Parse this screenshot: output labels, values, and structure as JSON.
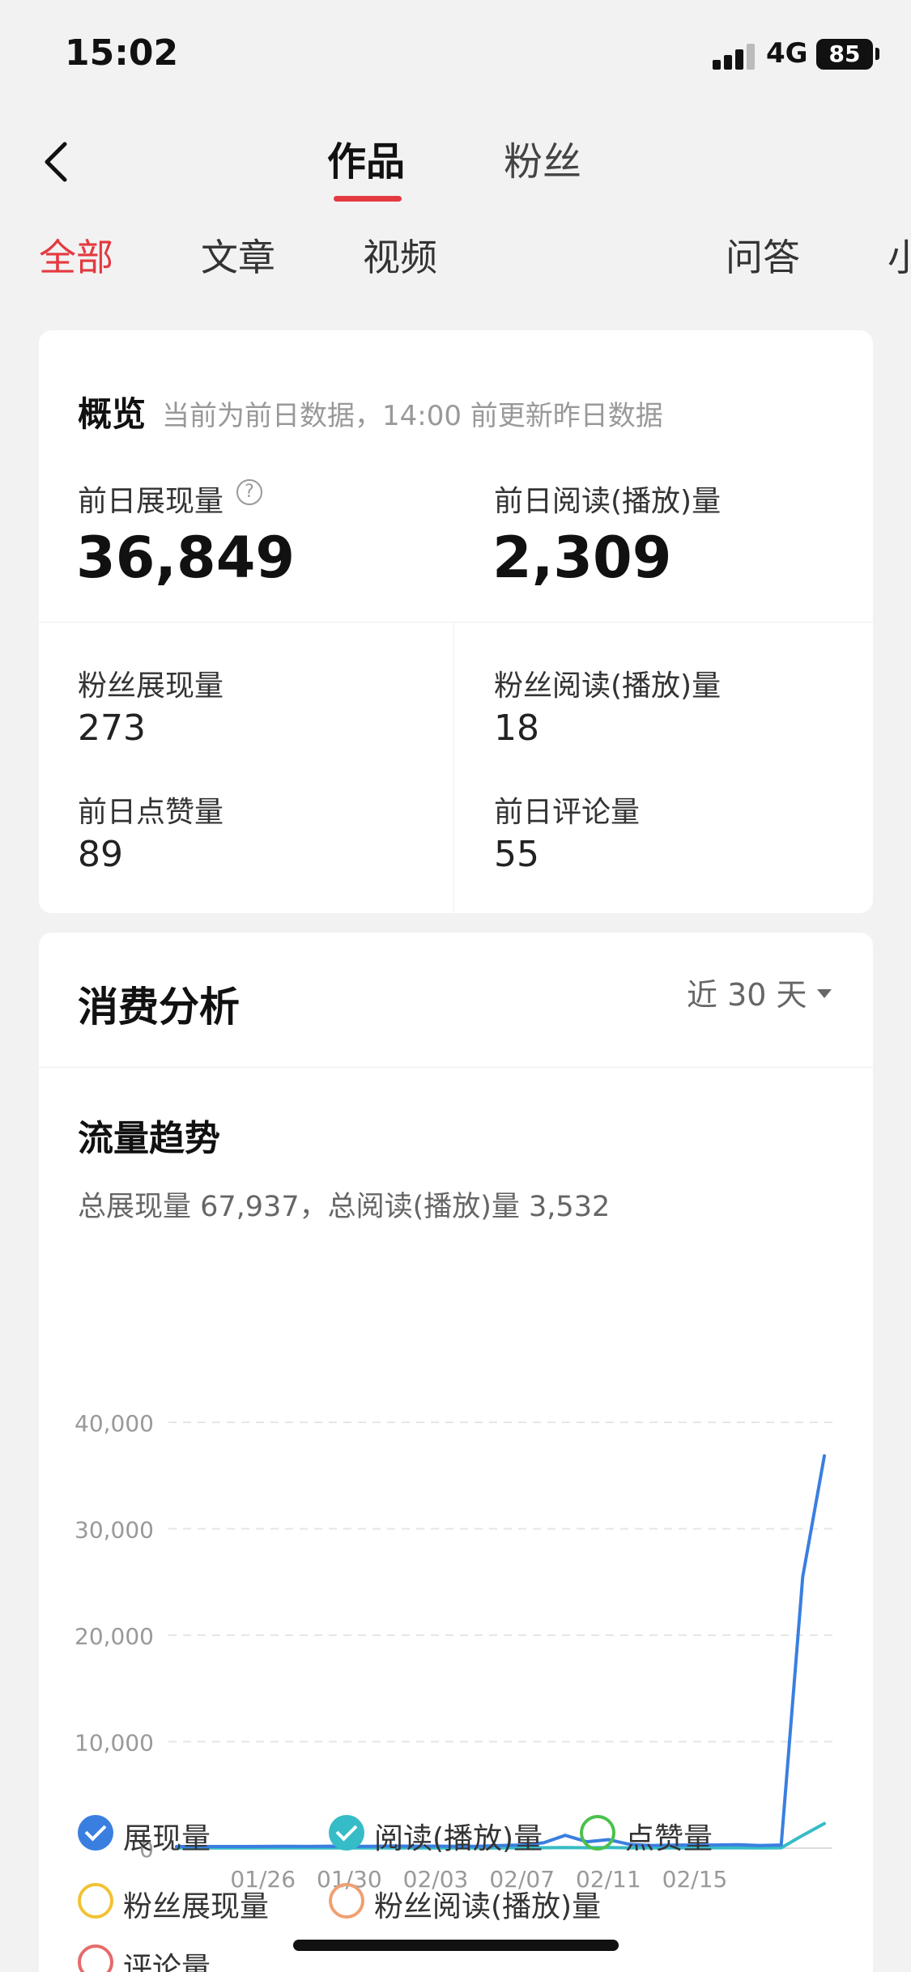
{
  "status_bar": {
    "time": "15:02",
    "network": "4G",
    "battery": "85"
  },
  "nav": {
    "tabs": [
      {
        "label": "作品"
      },
      {
        "label": "粉丝"
      }
    ],
    "categories": [
      {
        "label": "全部"
      },
      {
        "label": "文章"
      },
      {
        "label": "视频"
      },
      {
        "label": "问答"
      },
      {
        "label": "小"
      }
    ]
  },
  "overview": {
    "title": "概览",
    "subtitle": "当前为前日数据，14:00 前更新昨日数据",
    "impressions_label": "前日展现量",
    "impressions_value": "36,849",
    "reads_label": "前日阅读(播放)量",
    "reads_value": "2,309",
    "fan_impressions_label": "粉丝展现量",
    "fan_impressions_value": "273",
    "fan_reads_label": "粉丝阅读(播放)量",
    "fan_reads_value": "18",
    "likes_label": "前日点赞量",
    "likes_value": "89",
    "comments_label": "前日评论量",
    "comments_value": "55"
  },
  "consumption": {
    "title": "消费分析",
    "range": "近 30 天",
    "trend_title": "流量趋势",
    "trend_summary": "总展现量 67,937，总阅读(播放)量 3,532"
  },
  "chart_data": {
    "type": "line",
    "ylim": [
      0,
      40000
    ],
    "y_ticks": [
      "0",
      "10,000",
      "20,000",
      "30,000",
      "40,000"
    ],
    "x_tick_labels": [
      "01/26",
      "01/30",
      "02/03",
      "02/07",
      "02/11",
      "02/15"
    ],
    "x_tick_index": [
      4,
      8,
      12,
      16,
      20,
      24
    ],
    "grid": true,
    "series": [
      {
        "name": "展现量",
        "color": "#3a7fe0",
        "values": [
          150,
          150,
          150,
          150,
          160,
          170,
          160,
          180,
          160,
          170,
          200,
          180,
          190,
          170,
          180,
          250,
          300,
          500,
          1200,
          600,
          800,
          350,
          250,
          280,
          300,
          300,
          320,
          250,
          300,
          25500,
          36849
        ]
      },
      {
        "name": "阅读(播放)量",
        "color": "#36bcc6",
        "values": [
          20,
          20,
          20,
          20,
          20,
          20,
          20,
          20,
          20,
          20,
          20,
          20,
          20,
          20,
          20,
          20,
          30,
          40,
          60,
          40,
          50,
          30,
          25,
          25,
          30,
          30,
          30,
          25,
          30,
          1200,
          2309
        ]
      }
    ]
  },
  "legend": [
    {
      "label": "展现量",
      "color": "#3a7fe0",
      "checked": true
    },
    {
      "label": "阅读(播放)量",
      "color": "#36bcc6",
      "checked": true
    },
    {
      "label": "点赞量",
      "color": "#4cc14c",
      "checked": false
    },
    {
      "label": "粉丝展现量",
      "color": "#f1c233",
      "checked": false
    },
    {
      "label": "粉丝阅读(播放)量",
      "color": "#f0a070",
      "checked": false
    },
    {
      "label": "评论量",
      "color": "#e66b6b",
      "checked": false
    }
  ]
}
